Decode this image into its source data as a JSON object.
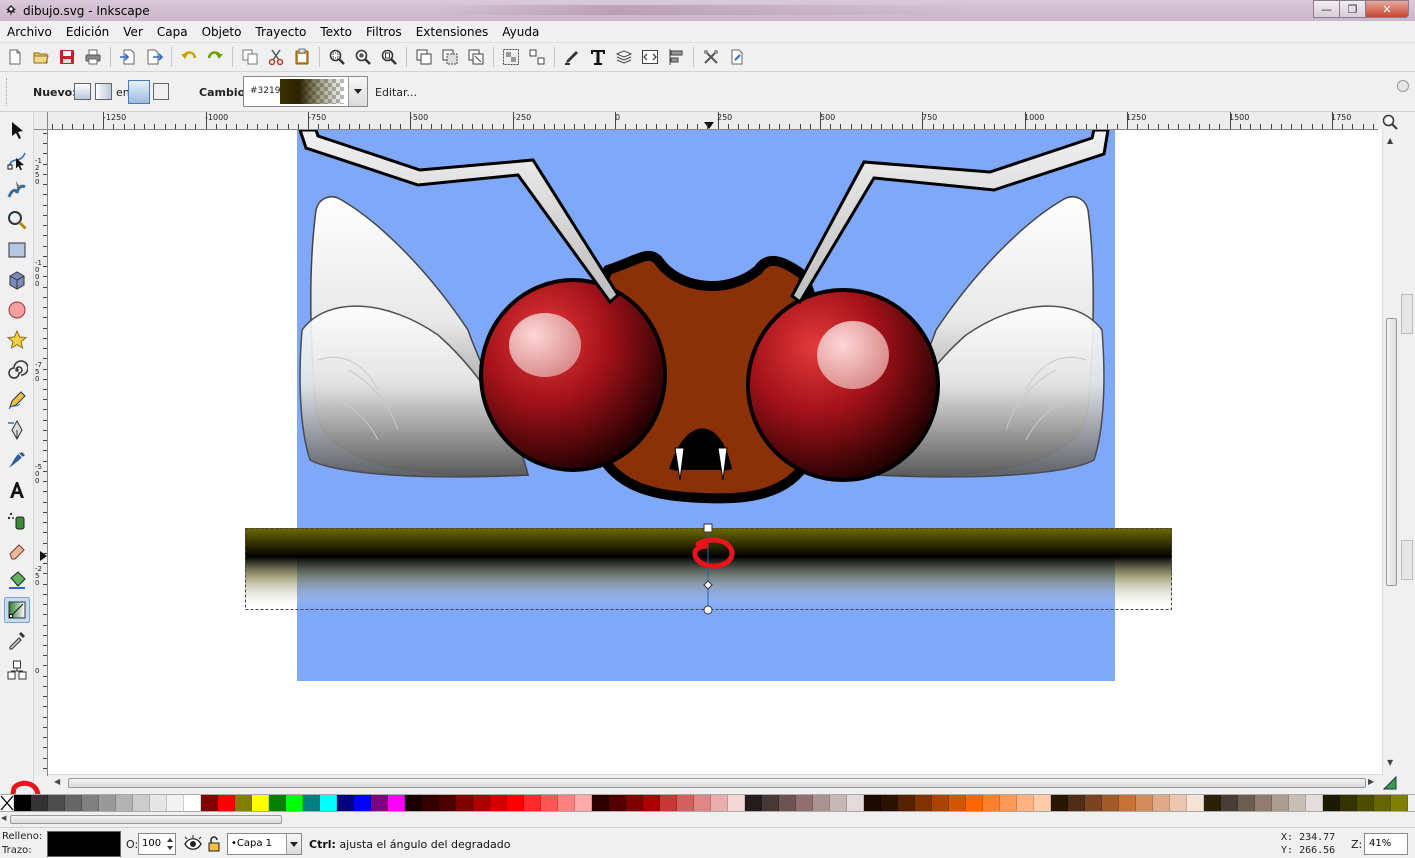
{
  "window": {
    "title": "dibujo.svg - Inkscape",
    "buttons": {
      "minimize": "—",
      "maximize": "❐",
      "close": "✕"
    }
  },
  "menu": [
    "Archivo",
    "Edición",
    "Ver",
    "Capa",
    "Objeto",
    "Trayecto",
    "Texto",
    "Filtros",
    "Extensiones",
    "Ayuda"
  ],
  "commands": [
    "new-icon",
    "open-icon",
    "save-icon",
    "print-icon",
    "import-icon",
    "export-icon",
    "undo-icon",
    "redo-icon",
    "copy-icon",
    "cut-icon",
    "paste-icon",
    "zoom-selection-icon",
    "zoom-drawing-icon",
    "zoom-page-icon",
    "duplicate-icon",
    "clone-icon",
    "unlink-clone-icon",
    "group-icon",
    "ungroup-icon",
    "fill-stroke-icon",
    "text-font-icon",
    "layers-icon",
    "xml-editor-icon",
    "align-icon",
    "preferences-icon",
    "document-properties-icon"
  ],
  "tool_controls": {
    "new_label": "Nuevo:",
    "on_label": "en",
    "change_label": "Cambio:",
    "gradient_id": "#3219",
    "edit_label": "Editar..."
  },
  "tools": [
    "selector-tool-icon",
    "node-tool-icon",
    "tweak-tool-icon",
    "zoom-tool-icon",
    "rectangle-tool-icon",
    "3d-box-tool-icon",
    "ellipse-tool-icon",
    "star-tool-icon",
    "spiral-tool-icon",
    "pencil-tool-icon",
    "pen-tool-icon",
    "calligraphy-tool-icon",
    "text-tool-icon",
    "spray-tool-icon",
    "eraser-tool-icon",
    "paint-bucket-tool-icon",
    "gradient-tool-icon",
    "dropper-tool-icon",
    "connector-tool-icon"
  ],
  "active_tool": "gradient-tool-icon",
  "ruler": {
    "h_labels": [
      "-1250",
      "-1000",
      "-750",
      "-500",
      "-250",
      "0",
      "250",
      "500",
      "750",
      "1000",
      "1250",
      "1500",
      "1750"
    ],
    "v_labels": [
      "-1250",
      "-1000",
      "-750",
      "-500",
      "-250",
      "0"
    ]
  },
  "palette": [
    "#000000",
    "#333333",
    "#4d4d4d",
    "#666666",
    "#808080",
    "#999999",
    "#b3b3b3",
    "#cccccc",
    "#e6e6e6",
    "#f2f2f2",
    "#ffffff",
    "#800000",
    "#ff0000",
    "#808000",
    "#ffff00",
    "#008000",
    "#00ff00",
    "#008080",
    "#00ffff",
    "#000080",
    "#0000ff",
    "#800080",
    "#ff00ff",
    "#1a0000",
    "#330000",
    "#4d0000",
    "#800000",
    "#aa0000",
    "#d40000",
    "#ff0000",
    "#ff2a2a",
    "#ff5555",
    "#ff8080",
    "#ffaaaa",
    "#2b0000",
    "#550000",
    "#800000",
    "#aa0000",
    "#c83737",
    "#d35f5f",
    "#de8787",
    "#e9afaf",
    "#f4d7d7",
    "#241c1c",
    "#483737",
    "#6c5353",
    "#916f6f",
    "#ac9393",
    "#c8b7b7",
    "#e3dbdb",
    "#1a0a00",
    "#2b1100",
    "#552200",
    "#803300",
    "#aa4400",
    "#d45500",
    "#ff6600",
    "#ff7f2a",
    "#ff9955",
    "#ffb380",
    "#ffccaa",
    "#281700",
    "#502d16",
    "#784421",
    "#a05a2c",
    "#c87137",
    "#d38d5f",
    "#deaa87",
    "#e9c6af",
    "#f4e3d7",
    "#28220b",
    "#483e37",
    "#6c5d53",
    "#917c6f",
    "#ac9d93",
    "#c8beb7",
    "#e3dedb",
    "#1a1a00",
    "#333300",
    "#4d4d00",
    "#666600",
    "#808000"
  ],
  "status": {
    "fill_label": "Relleno:",
    "stroke_label": "Trazo:",
    "opacity_label": "O:",
    "opacity_value": "100",
    "layer": "•Capa 1",
    "message_key": "Ctrl:",
    "message": "ajusta el ángulo del degradado",
    "x_label": "X:",
    "x_value": "234.77",
    "y_label": "Y:",
    "y_value": "266.56",
    "zoom_label": "Z:",
    "zoom_value": "41%"
  },
  "colors": {
    "canvas_bg": "#80a8f8",
    "page": "#ffffff",
    "annotation": "#e8131b"
  }
}
